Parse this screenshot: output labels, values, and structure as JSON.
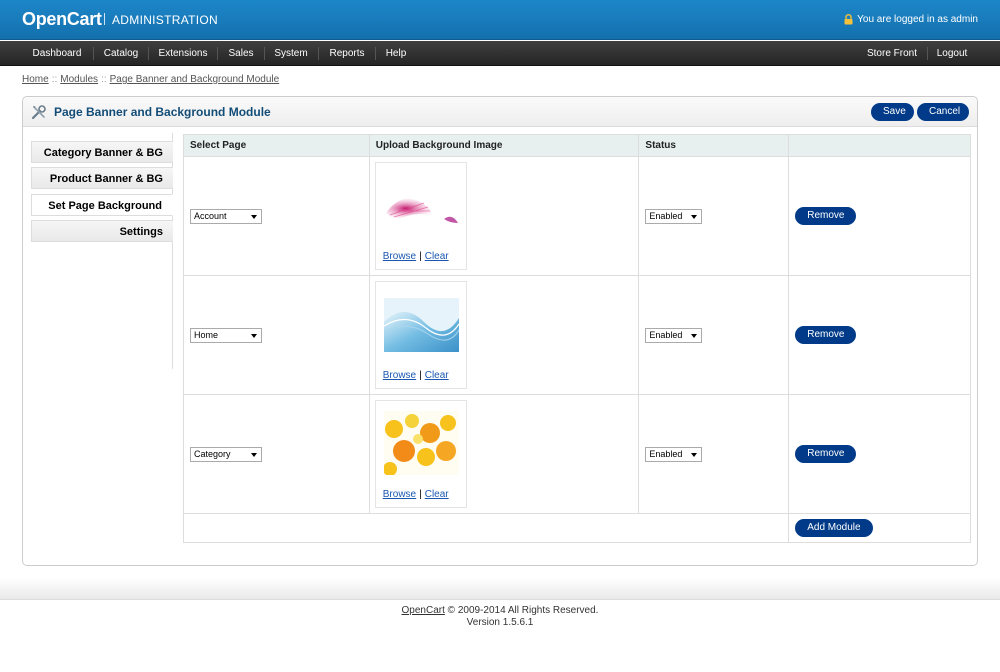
{
  "header": {
    "logo": "OpenCart",
    "subtitle": "ADMINISTRATION",
    "logged_in_text": "You are logged in as admin"
  },
  "menu": {
    "left": [
      "Dashboard",
      "Catalog",
      "Extensions",
      "Sales",
      "System",
      "Reports",
      "Help"
    ],
    "right": [
      "Store Front",
      "Logout"
    ]
  },
  "breadcrumb": [
    "Home",
    "Modules",
    "Page Banner and Background Module"
  ],
  "breadcrumb_separator": "::",
  "page": {
    "title": "Page Banner and Background Module",
    "save_label": "Save",
    "cancel_label": "Cancel"
  },
  "tabs": [
    "Category Banner & BG",
    "Product Banner & BG",
    "Set Page Background",
    "Settings"
  ],
  "active_tab": "Set Page Background",
  "table": {
    "headers": [
      "Select Page",
      "Upload Background Image",
      "Status",
      ""
    ],
    "rows": [
      {
        "page": "Account",
        "image": "pink-feather",
        "browse": "Browse",
        "clear": "Clear",
        "status": "Enabled",
        "remove": "Remove"
      },
      {
        "page": "Home",
        "image": "blue-waves",
        "browse": "Browse",
        "clear": "Clear",
        "status": "Enabled",
        "remove": "Remove"
      },
      {
        "page": "Category",
        "image": "orange-bubbles",
        "browse": "Browse",
        "clear": "Clear",
        "status": "Enabled",
        "remove": "Remove"
      }
    ],
    "link_separator": "|",
    "add_module_label": "Add Module"
  },
  "footer": {
    "brand_link": "OpenCart",
    "copyright": "© 2009-2014 All Rights Reserved.",
    "version": "Version 1.5.6.1"
  },
  "colors": {
    "header_blue": "#1a7dbd",
    "menu_dark": "#2f2f2f",
    "button_navy": "#003a88",
    "title_blue": "#134d77",
    "table_header_bg": "#e7efef"
  }
}
